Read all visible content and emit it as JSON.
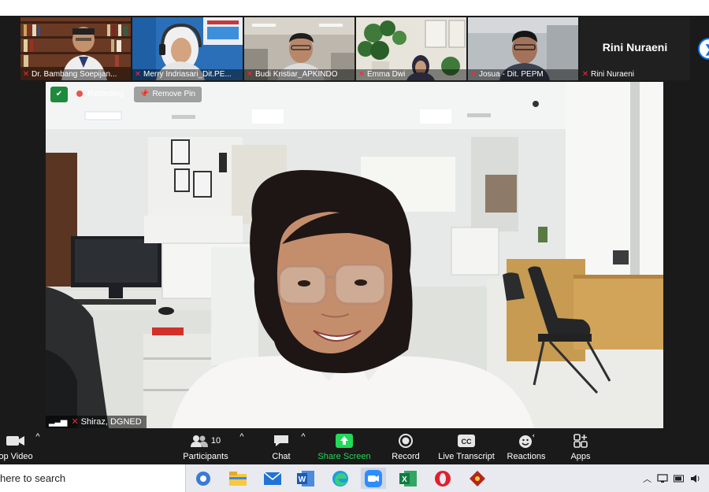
{
  "participants_strip": [
    {
      "name": "Dr. Bambang Soepijan...",
      "muted": true
    },
    {
      "name": "Merry Indriasari_Dit.PE...",
      "muted": true
    },
    {
      "name": "Budi Kristiar_APKINDO",
      "muted": true
    },
    {
      "name": "Emma Dwi",
      "muted": true
    },
    {
      "name": "Josua - Dit. PEPM",
      "muted": true
    },
    {
      "name": "Rini Nuraeni",
      "muted": true,
      "video_off": true,
      "display_name": "Rini Nuraeni"
    }
  ],
  "pinned": {
    "recording_label": "Recording",
    "remove_pin_label": "Remove Pin",
    "speaker_name": "Shiraz, DGNED"
  },
  "toolbar": {
    "video_label": "op Video",
    "participants_label": "Participants",
    "participants_count": "10",
    "chat_label": "Chat",
    "share_label": "Share Screen",
    "record_label": "Record",
    "transcript_label": "Live Transcript",
    "reactions_label": "Reactions",
    "apps_label": "Apps"
  },
  "taskbar": {
    "search_text": "here to search"
  },
  "colors": {
    "accent_green": "#23d959",
    "mute_red": "#e0323c",
    "zoom_blue": "#0e72ed"
  }
}
